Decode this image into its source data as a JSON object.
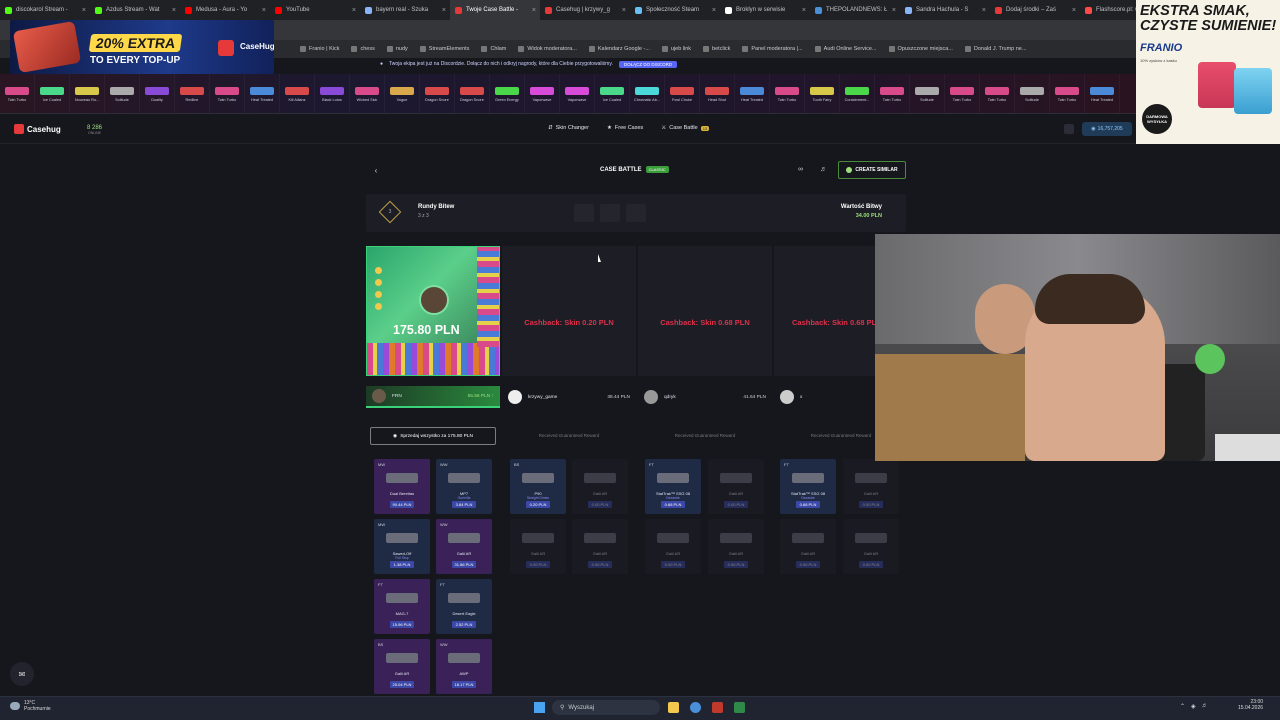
{
  "browser": {
    "tabs": [
      {
        "label": "discokarol Stream -",
        "color": "#53fc18"
      },
      {
        "label": "Azdus Stream - Wat",
        "color": "#53fc18"
      },
      {
        "label": "Medusa - Aura - Yo",
        "color": "#ff0000"
      },
      {
        "label": "YouTube",
        "color": "#ff0000"
      },
      {
        "label": "bayern real - Szuka",
        "color": "#8ab4f8"
      },
      {
        "label": "Twoje Case Battle -",
        "color": "#e63939",
        "active": true
      },
      {
        "label": "Casehug | krzywy_g",
        "color": "#e63939"
      },
      {
        "label": "Społeczność Steam",
        "color": "#66c0f4"
      },
      {
        "label": "Broklyn w serwisie",
        "color": "#ffffff"
      },
      {
        "label": "THEPOLANDNEWS: Ł",
        "color": "#4a90d9"
      },
      {
        "label": "Sandra Hachula - S",
        "color": "#8ab4f8"
      },
      {
        "label": "Dodaj środki – Zaś",
        "color": "#e63939"
      },
      {
        "label": "Flashscore.pl: w",
        "color": "#ff4a4a"
      }
    ],
    "bookmarks": [
      "Franio | Kick",
      "chess",
      "nudy",
      "StreamElements",
      "Chłam",
      "Widok moderatora...",
      "Kalendarz Google -...",
      "ujeb link",
      "betclick",
      "Panel moderatora |...",
      "Audi Online Service...",
      "Opuszczone miejsca...",
      "Donald J. Trump ne..."
    ]
  },
  "promo": {
    "percent": "20% EXTRA",
    "text": "TO EVERY TOP-UP",
    "brand": "CaseHug"
  },
  "discord": {
    "text": "Twoja ekipa jest już na Discordzie. Dołącz do nich i odkryj nagrody, które dla Ciebie przygotowaliśmy.",
    "button": "DOŁĄCZ DO DISCORD"
  },
  "skin_strip": [
    {
      "name": "Twin Turbo",
      "color": "#d84a8a"
    },
    {
      "name": "Ice Coaled",
      "color": "#4ad88a"
    },
    {
      "name": "Nouveau Ro...",
      "color": "#d8c84a"
    },
    {
      "name": "Solitude",
      "color": "#aaaaaa"
    },
    {
      "name": "Duality",
      "color": "#8a4ad8"
    },
    {
      "name": "Redline",
      "color": "#d84a4a"
    },
    {
      "name": "Twin Turbo",
      "color": "#d84a8a"
    },
    {
      "name": "Heat Treated",
      "color": "#4a8ad8"
    },
    {
      "name": "Kill Allianz",
      "color": "#d84a4a"
    },
    {
      "name": "Black Lotus",
      "color": "#8a4ad8"
    },
    {
      "name": "Wicked Sick",
      "color": "#d84a8a"
    },
    {
      "name": "Vogue",
      "color": "#d8a84a"
    },
    {
      "name": "Dragon Snore",
      "color": "#d84a4a"
    },
    {
      "name": "Dragon Snore",
      "color": "#d84a4a"
    },
    {
      "name": "Green Energy",
      "color": "#4ad84a"
    },
    {
      "name": "Vaporwave",
      "color": "#d84ad8"
    },
    {
      "name": "Vaporwave",
      "color": "#d84ad8"
    },
    {
      "name": "Ice Coaled",
      "color": "#4ad88a"
    },
    {
      "name": "Chromatic Ab...",
      "color": "#4ad8d8"
    },
    {
      "name": "Fowl Choke",
      "color": "#d84a4a"
    },
    {
      "name": "Head Shot",
      "color": "#d84a4a"
    },
    {
      "name": "Heat Treated",
      "color": "#4a8ad8"
    },
    {
      "name": "Twin Turbo",
      "color": "#d84a8a"
    },
    {
      "name": "Tooth Fairy",
      "color": "#d8c84a"
    },
    {
      "name": "Containment...",
      "color": "#4ad84a"
    },
    {
      "name": "Twin Turbo",
      "color": "#d84a8a"
    },
    {
      "name": "Solitude",
      "color": "#aaaaaa"
    },
    {
      "name": "Twin Turbo",
      "color": "#d84a8a"
    },
    {
      "name": "Twin Turbo",
      "color": "#d84a8a"
    },
    {
      "name": "Solitude",
      "color": "#aaaaaa"
    },
    {
      "name": "Twin Turbo",
      "color": "#d84a8a"
    },
    {
      "name": "Heat Treated",
      "color": "#4a8ad8"
    }
  ],
  "site": {
    "logo": "Casehug",
    "online_count": "8 286",
    "online_label": "ONLINE",
    "nav": [
      "Skin Changer",
      "Free Cases",
      "Case Battle"
    ],
    "nav_badge": "13",
    "balance": "16,757,205"
  },
  "ad": {
    "headline": "EKSTRA SMAK, CZYSTE SUMIENIE!",
    "brand": "FRANIO",
    "sub": "10% zysków z kasku",
    "badge": "DARMOWA WYSYŁKA"
  },
  "battle": {
    "title": "CASE BATTLE",
    "mode": "CLASSIC",
    "create_similar": "CREATE SIMILAR",
    "rounds_label": "Rundy Bitew",
    "rounds_count": "3 z 3",
    "rounds_number": "3",
    "value_label": "Wartość Bitwy",
    "value": "34.00 PLN",
    "winner_amount": "175.80 PLN",
    "cashbacks": [
      "Cashback: Skin 0.20 PLN",
      "Cashback: Skin 0.68 PLN",
      "Cashback: Skin 0.68 PLN"
    ],
    "players": [
      {
        "name": "FRN",
        "value": "55.56 PLN ↑"
      },
      {
        "name": "krzywy_game",
        "value": "38.44 PLN"
      },
      {
        "name": "qdryk",
        "value": "41.64 PLN"
      },
      {
        "name": "x",
        "value": ""
      }
    ],
    "sell_all": "Sprzedaj wszystko za 175.80 PLN",
    "guaranteed": "Received Guaranteed Reward"
  },
  "items": {
    "winner": [
      {
        "q": "MW",
        "name": "Dual Berettas",
        "sub": "",
        "price": "90.44 PLN",
        "style": "purple"
      },
      {
        "q": "WW",
        "name": "MP7",
        "sub": "Guerrilla",
        "price": "3.84 PLN",
        "style": "blue"
      },
      {
        "q": "MW",
        "name": "Sawed-Off",
        "sub": "Full Stop",
        "price": "1.38 PLN",
        "style": "blue"
      },
      {
        "q": "WW",
        "name": "Galil AR",
        "sub": "",
        "price": "31.86 PLN",
        "style": "purple"
      },
      {
        "q": "FT",
        "name": "MAG-7",
        "sub": "",
        "price": "15.96 PLN",
        "style": "purple"
      },
      {
        "q": "FT",
        "name": "Desert Eagle",
        "sub": "",
        "price": "2.52 PLN",
        "style": "blue"
      },
      {
        "q": "BS",
        "name": "Galil AR",
        "sub": "",
        "price": "25.04 PLN",
        "style": "purple"
      },
      {
        "q": "WW",
        "name": "AWP",
        "sub": "",
        "price": "18.17 PLN",
        "style": "purple"
      }
    ],
    "p2": {
      "q": "BS",
      "name": "P90",
      "sub": "Straight Dimes",
      "price": "0.20 PLN"
    },
    "p3": {
      "q": "FT",
      "name": "StatTrak™ SSG 08",
      "sub": "Dezastre",
      "price": "0.68 PLN"
    },
    "p4": {
      "q": "FT",
      "name": "StatTrak™ SSG 08",
      "sub": "Dezastre",
      "price": "0.68 PLN"
    },
    "dim": {
      "name": "Galil AR",
      "price": "0.00 PLN"
    }
  },
  "taskbar": {
    "temp": "13°C",
    "weather": "Pochmurnie",
    "search": "Wyszukaj",
    "time": "23:00",
    "date": "15.04.2026"
  }
}
